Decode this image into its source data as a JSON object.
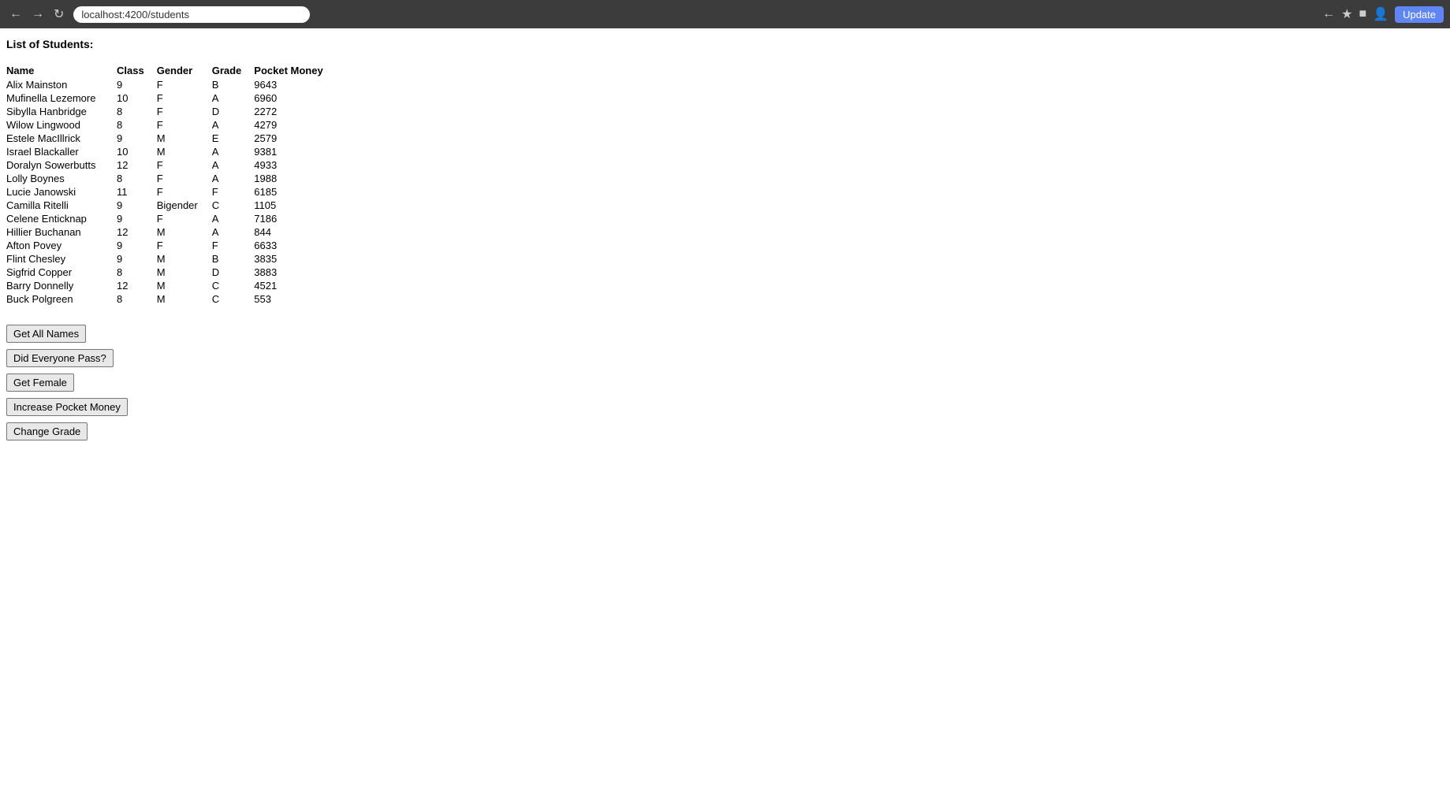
{
  "browser": {
    "url": "localhost:4200/students",
    "update_label": "Update"
  },
  "page": {
    "title": "List of Students:"
  },
  "table": {
    "headers": [
      "Name",
      "Class",
      "Gender",
      "Grade",
      "Pocket Money"
    ],
    "rows": [
      {
        "name": "Alix Mainston",
        "class": "9",
        "gender": "F",
        "grade": "B",
        "pocket_money": "9643"
      },
      {
        "name": "Mufinella Lezemore",
        "class": "10",
        "gender": "F",
        "grade": "A",
        "pocket_money": "6960"
      },
      {
        "name": "Sibylla Hanbridge",
        "class": "8",
        "gender": "F",
        "grade": "D",
        "pocket_money": "2272"
      },
      {
        "name": "Wilow Lingwood",
        "class": "8",
        "gender": "F",
        "grade": "A",
        "pocket_money": "4279"
      },
      {
        "name": "Estele MacIllrick",
        "class": "9",
        "gender": "M",
        "grade": "E",
        "pocket_money": "2579"
      },
      {
        "name": "Israel Blackaller",
        "class": "10",
        "gender": "M",
        "grade": "A",
        "pocket_money": "9381"
      },
      {
        "name": "Doralyn Sowerbutts",
        "class": "12",
        "gender": "F",
        "grade": "A",
        "pocket_money": "4933"
      },
      {
        "name": "Lolly Boynes",
        "class": "8",
        "gender": "F",
        "grade": "A",
        "pocket_money": "1988"
      },
      {
        "name": "Lucie Janowski",
        "class": "11",
        "gender": "F",
        "grade": "F",
        "pocket_money": "6185"
      },
      {
        "name": "Camilla Ritelli",
        "class": "9",
        "gender": "Bigender",
        "grade": "C",
        "pocket_money": "1105"
      },
      {
        "name": "Celene Enticknap",
        "class": "9",
        "gender": "F",
        "grade": "A",
        "pocket_money": "7186"
      },
      {
        "name": "Hillier Buchanan",
        "class": "12",
        "gender": "M",
        "grade": "A",
        "pocket_money": "844"
      },
      {
        "name": "Afton Povey",
        "class": "9",
        "gender": "F",
        "grade": "F",
        "pocket_money": "6633"
      },
      {
        "name": "Flint Chesley",
        "class": "9",
        "gender": "M",
        "grade": "B",
        "pocket_money": "3835"
      },
      {
        "name": "Sigfrid Copper",
        "class": "8",
        "gender": "M",
        "grade": "D",
        "pocket_money": "3883"
      },
      {
        "name": "Barry Donnelly",
        "class": "12",
        "gender": "M",
        "grade": "C",
        "pocket_money": "4521"
      },
      {
        "name": "Buck Polgreen",
        "class": "8",
        "gender": "M",
        "grade": "C",
        "pocket_money": "553"
      }
    ]
  },
  "buttons": {
    "get_all_names": "Get All Names",
    "did_everyone_pass": "Did Everyone Pass?",
    "get_female": "Get Female",
    "increase_pocket_money": "Increase Pocket Money",
    "change_grade": "Change Grade"
  }
}
